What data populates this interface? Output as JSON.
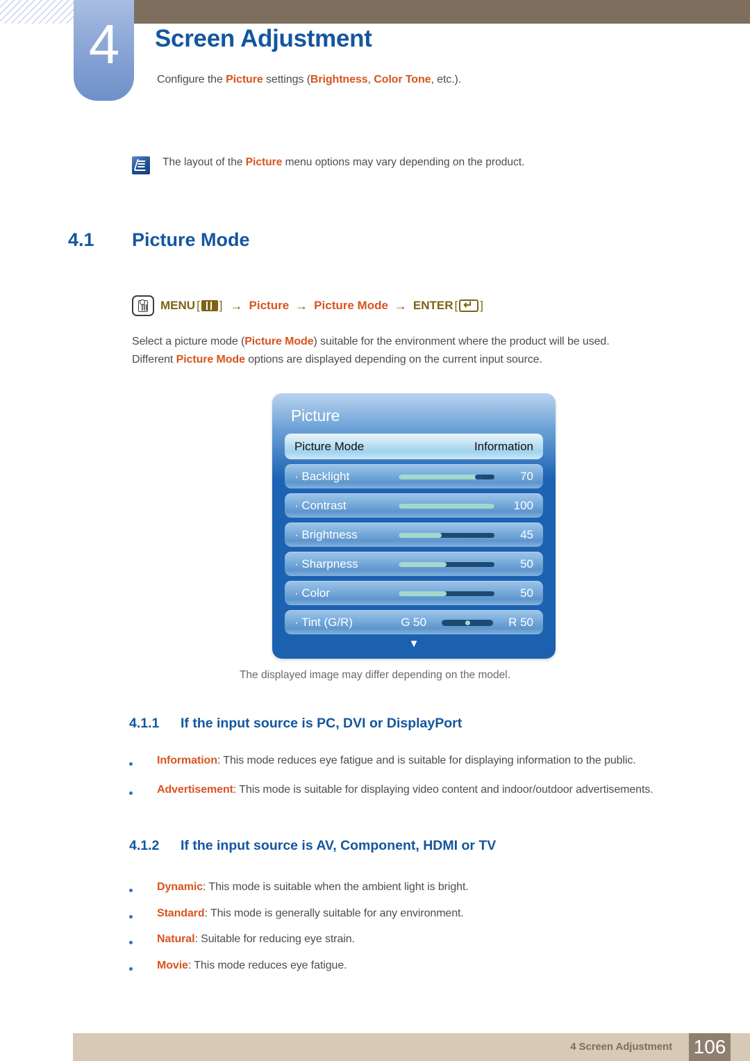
{
  "header": {
    "chapter_number": "4",
    "chapter_title": "Screen Adjustment",
    "subtitle_parts": {
      "p1": "Configure the ",
      "kw1": "Picture",
      "p2": " settings (",
      "kw2": "Brightness",
      "p3": ", ",
      "kw3": "Color Tone",
      "p4": ", etc.)."
    }
  },
  "note": {
    "icon": "note-pen-icon",
    "text_parts": {
      "p1": "The layout of the ",
      "kw1": "Picture",
      "p2": " menu options may vary depending on the product."
    }
  },
  "section": {
    "number": "4.1",
    "title": "Picture Mode"
  },
  "menu_path": {
    "touch_icon": "touch-button-icon",
    "menu_label": "MENU",
    "menu_key_icon": "menu-key-icon",
    "arrow": "→",
    "step1": "Picture",
    "step2": "Picture Mode",
    "enter_label": "ENTER",
    "enter_key_icon": "enter-key-icon",
    "bracket_open": "[",
    "bracket_close": "]"
  },
  "paragraph": {
    "line1_p1": "Select a picture mode (",
    "line1_kw": "Picture Mode",
    "line1_p2": ") suitable for the environment where the product will be used.",
    "line2_p1": "Different ",
    "line2_kw": "Picture Mode",
    "line2_p2": " options are displayed depending on the current input source."
  },
  "osd": {
    "title": "Picture",
    "rows": [
      {
        "label": "Picture Mode",
        "value": "Information",
        "selected": true,
        "type": "option"
      },
      {
        "label": "· Backlight",
        "value": "70",
        "type": "slider",
        "fill_pct": 88,
        "knob": true
      },
      {
        "label": "· Contrast",
        "value": "100",
        "type": "slider",
        "fill_pct": 100,
        "knob": false
      },
      {
        "label": "· Brightness",
        "value": "45",
        "type": "slider",
        "fill_pct": 45,
        "knob": false
      },
      {
        "label": "· Sharpness",
        "value": "50",
        "type": "slider",
        "fill_pct": 50,
        "knob": false
      },
      {
        "label": "· Color",
        "value": "50",
        "type": "slider",
        "fill_pct": 50,
        "knob": false
      },
      {
        "label": "· Tint (G/R)",
        "type": "tint",
        "left_value": "G 50",
        "right_value": "R 50",
        "position_pct": 50
      }
    ],
    "scroll_arrow": "▼",
    "caption": "The displayed image may differ depending on the model."
  },
  "subsections": [
    {
      "number": "4.1.1",
      "title": "If the input source is PC, DVI or DisplayPort",
      "bullets": [
        {
          "term": "Information",
          "desc": ": This mode reduces eye fatigue and is suitable for displaying information to the public."
        },
        {
          "term": "Advertisement",
          "desc": ": This mode is suitable for displaying video content and indoor/outdoor advertisements."
        }
      ]
    },
    {
      "number": "4.1.2",
      "title": "If the input source is AV, Component, HDMI or TV",
      "bullets": [
        {
          "term": "Dynamic",
          "desc": ": This mode is suitable when the ambient light is bright."
        },
        {
          "term": "Standard",
          "desc": ": This mode is generally suitable for any environment."
        },
        {
          "term": "Natural",
          "desc": ": Suitable for reducing eye strain."
        },
        {
          "term": "Movie",
          "desc": ": This mode reduces eye fatigue."
        }
      ]
    }
  ],
  "footer": {
    "text": "4 Screen Adjustment",
    "page_number": "106"
  },
  "colors": {
    "accent_blue": "#14569e",
    "keyword_orange": "#d8541f",
    "header_brown": "#7d6e5e",
    "footer_tan": "#d6c9b6",
    "osd_blue": "#1c63b4"
  }
}
